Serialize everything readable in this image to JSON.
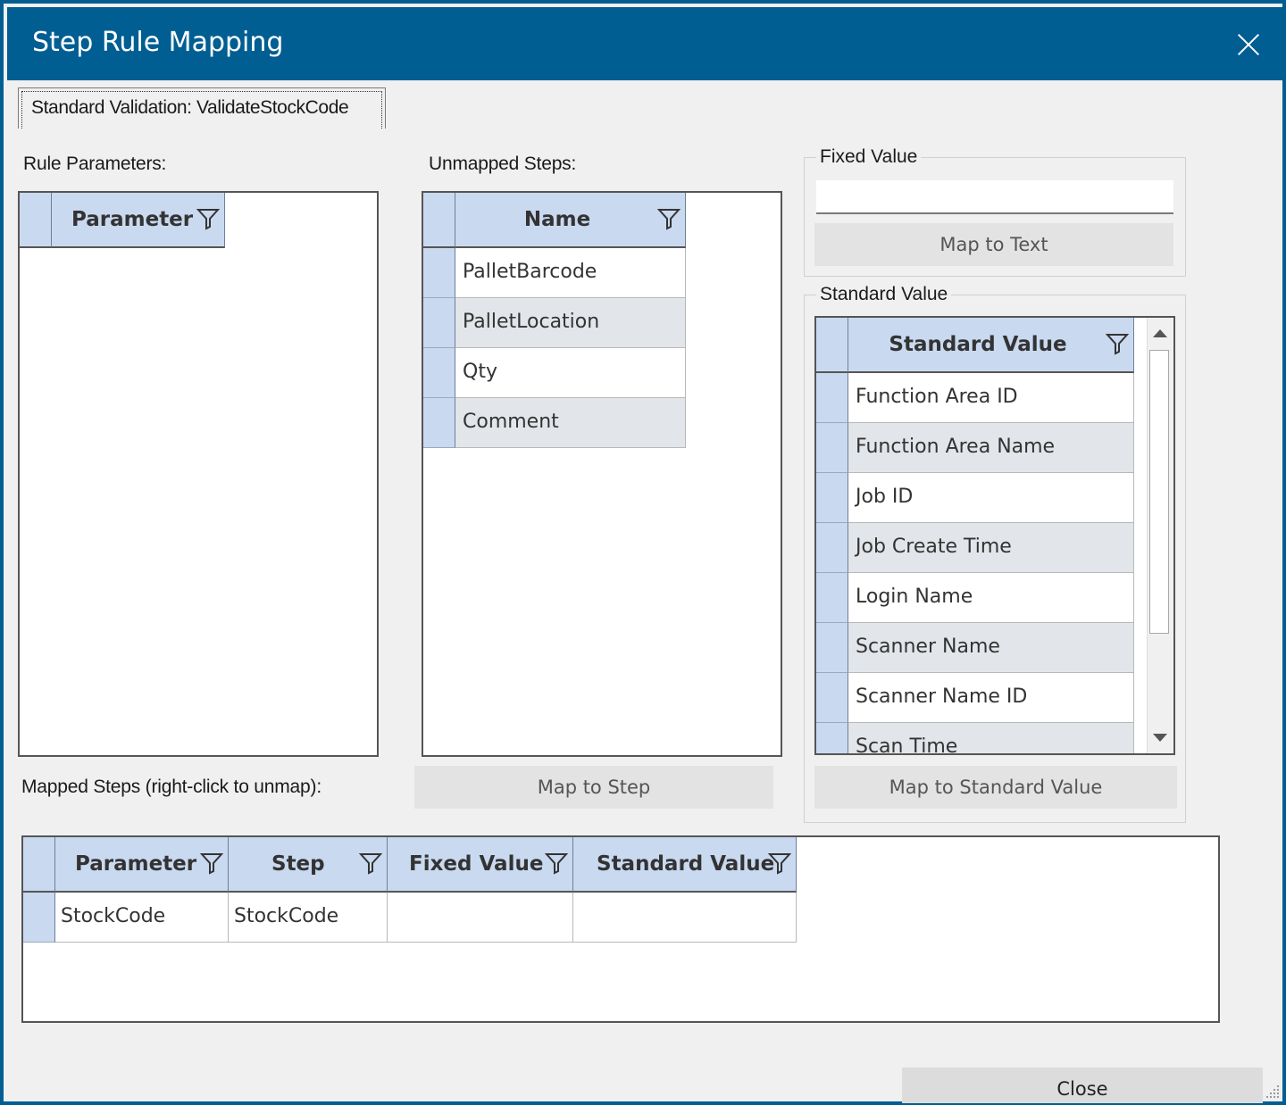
{
  "window": {
    "title": "Step Rule Mapping",
    "close_icon": "close-icon",
    "titlebar_color": "#005e92"
  },
  "tab": {
    "label": "Standard Validation: ValidateStockCode"
  },
  "rule_parameters": {
    "label": "Rule Parameters:",
    "columns": [
      "Parameter"
    ],
    "rows": []
  },
  "unmapped_steps": {
    "label": "Unmapped Steps:",
    "columns": [
      "Name"
    ],
    "rows": [
      "PalletBarcode",
      "PalletLocation",
      "Qty",
      "Comment"
    ],
    "button": "Map to Step"
  },
  "fixed_value": {
    "group_title": "Fixed Value",
    "input_value": "",
    "button": "Map to Text"
  },
  "standard_value": {
    "group_title": "Standard Value",
    "columns": [
      "Standard Value"
    ],
    "rows": [
      "Function Area ID",
      "Function Area Name",
      "Job ID",
      "Job Create Time",
      "Login Name",
      "Scanner Name",
      "Scanner Name ID",
      "Scan Time"
    ],
    "button": "Map to Standard Value"
  },
  "mapped_steps": {
    "label": "Mapped Steps (right-click to unmap):",
    "columns": [
      "Parameter",
      "Step",
      "Fixed Value",
      "Standard Value"
    ],
    "rows": [
      {
        "parameter": "StockCode",
        "step": "StockCode",
        "fixed_value": "",
        "standard_value": ""
      }
    ]
  },
  "footer": {
    "close_button": "Close"
  },
  "colors": {
    "header_bg": "#c9d9f0",
    "alt_row": "#e2e6ea"
  }
}
